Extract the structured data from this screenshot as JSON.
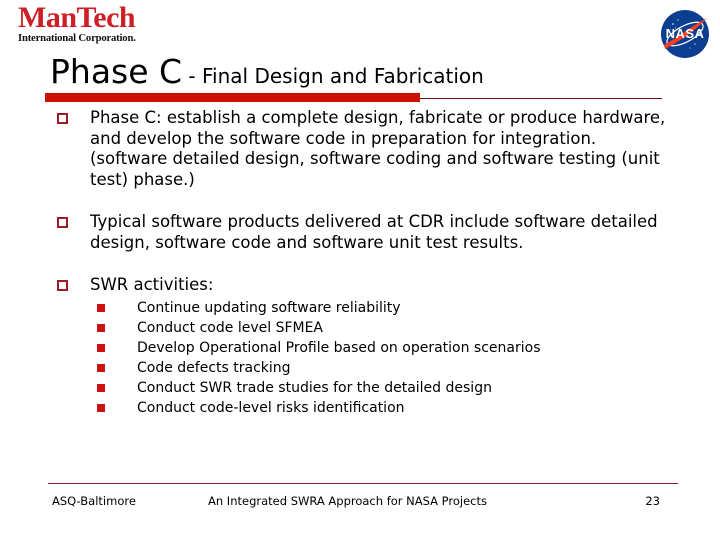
{
  "slide": {
    "title_main": "Phase C",
    "title_sub": " - Final Design and Fabrication",
    "accent_red": "#cc1100",
    "bullet_marker_color": "#9e1b28",
    "subbullet_marker_color": "#cc1111"
  },
  "logos": {
    "mantech_word": "ManTech",
    "mantech_sub": "International Corporation.",
    "mantech_color": "#cc2026",
    "nasa_name": "NASA",
    "nasa_blue": "#0b3d91",
    "nasa_red": "#fc3d21"
  },
  "bullets": [
    {
      "text": "Phase C: establish a complete design, fabricate or produce hardware, and develop the software code in preparation for integration.  (software detailed design, software coding and software testing (unit test) phase.)"
    },
    {
      "text": "Typical software products delivered at CDR include software detailed design, software code and software unit test results."
    },
    {
      "text": "SWR activities:",
      "sub": [
        "Continue updating software reliability",
        "Conduct  code level SFMEA",
        "Develop Operational Profile based on operation scenarios",
        "Code defects tracking",
        "Conduct SWR trade studies for the detailed design",
        "Conduct code-level risks identification"
      ]
    }
  ],
  "footer": {
    "left": "ASQ-Baltimore",
    "center": "An Integrated SWRA Approach for NASA Projects",
    "right": "23"
  }
}
